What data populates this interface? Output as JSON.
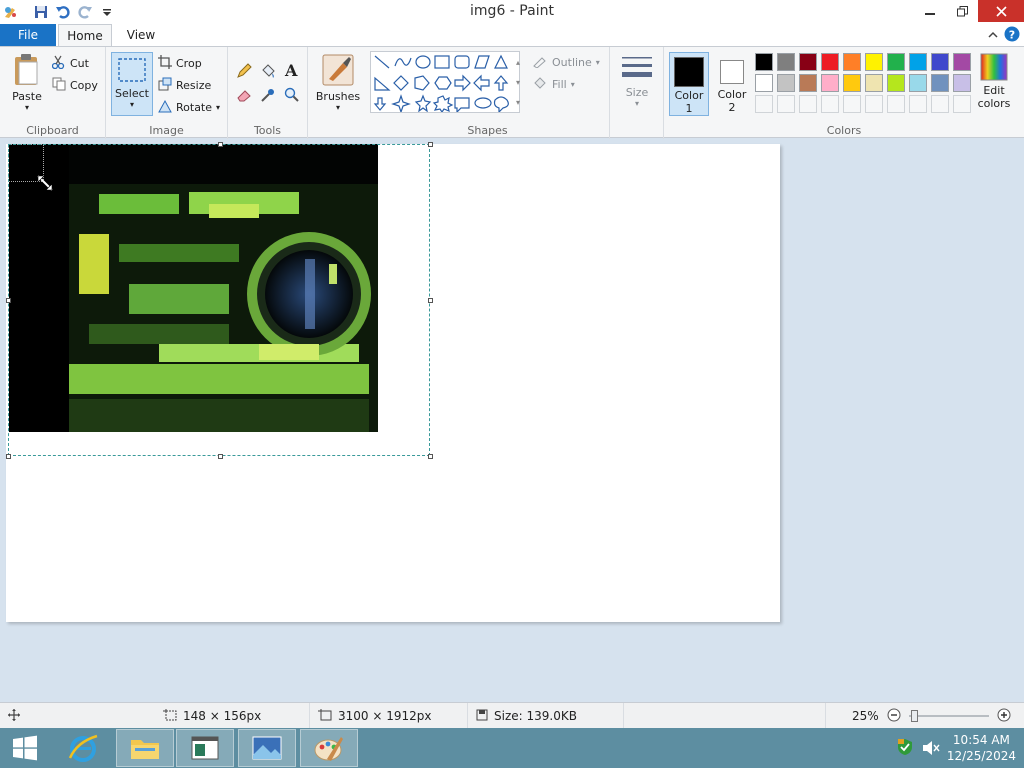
{
  "window": {
    "title": "img6 - Paint"
  },
  "tabs": {
    "file": "File",
    "home": "Home",
    "view": "View"
  },
  "clipboard": {
    "paste": "Paste",
    "cut": "Cut",
    "copy": "Copy",
    "label": "Clipboard"
  },
  "image_group": {
    "select": "Select",
    "crop": "Crop",
    "resize": "Resize",
    "rotate": "Rotate",
    "label": "Image"
  },
  "tools": {
    "label": "Tools"
  },
  "brushes": {
    "label": "Brushes"
  },
  "shapes": {
    "outline": "Outline",
    "fill": "Fill",
    "label": "Shapes"
  },
  "size": {
    "label": "Size"
  },
  "colors": {
    "color1": "Color",
    "color1_num": "1",
    "color2": "Color",
    "color2_num": "2",
    "edit1": "Edit",
    "edit2": "colors",
    "label": "Colors",
    "color1_value": "#000000",
    "color2_value": "#ffffff",
    "palette_row1": [
      "#000000",
      "#7f7f7f",
      "#880015",
      "#ed1c24",
      "#ff7f27",
      "#fff200",
      "#22b14c",
      "#00a2e8",
      "#3f48cc",
      "#a349a4"
    ],
    "palette_row2": [
      "#ffffff",
      "#c3c3c3",
      "#b97a57",
      "#ffaec9",
      "#ffc90e",
      "#efe4b0",
      "#b5e61d",
      "#99d9ea",
      "#7092be",
      "#c8bfe7"
    ]
  },
  "status": {
    "selection_size": "148 × 156px",
    "image_size": "3100 × 1912px",
    "file_size": "Size: 139.0KB",
    "zoom": "25%"
  },
  "taskbar": {
    "time": "10:54 AM",
    "date": "12/25/2024"
  }
}
